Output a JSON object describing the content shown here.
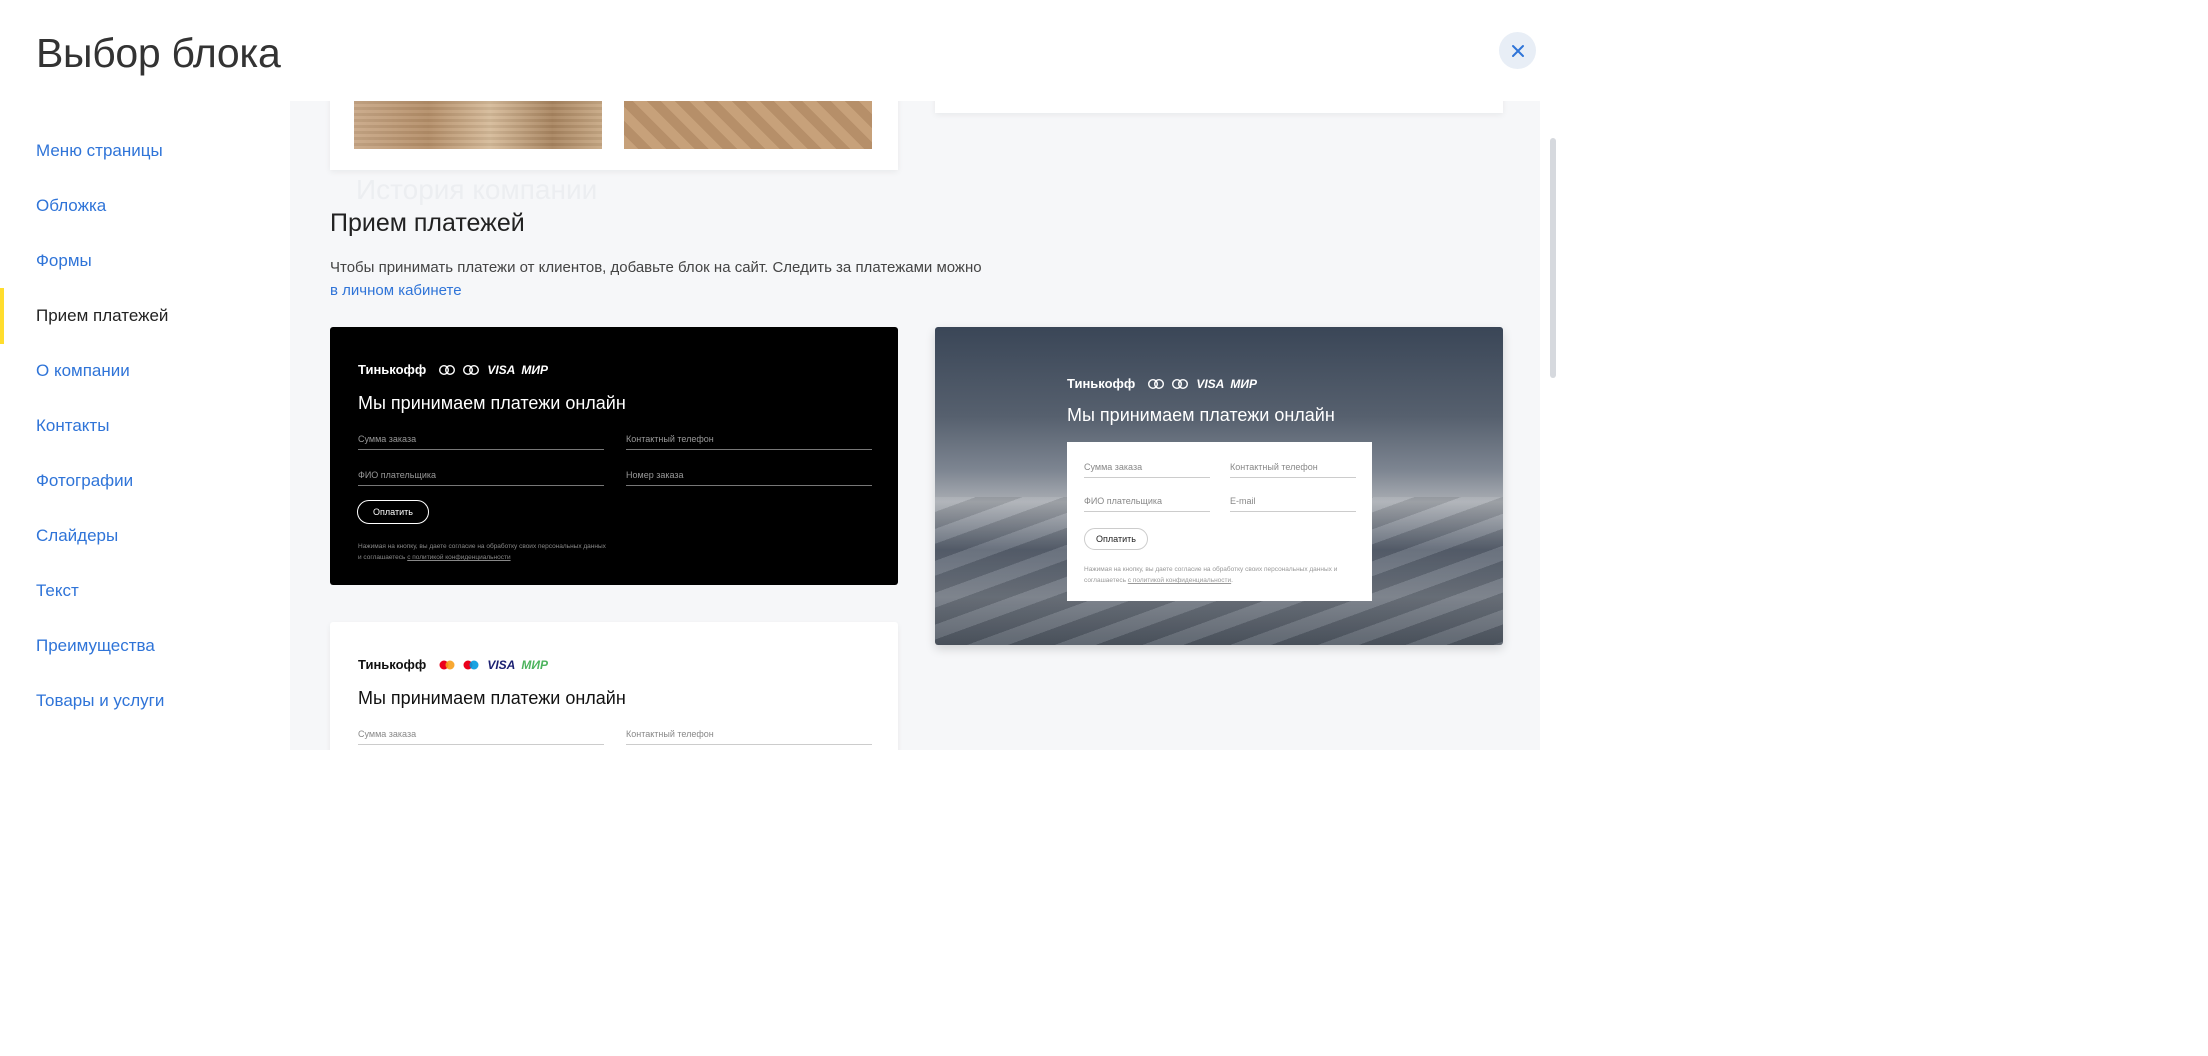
{
  "header": {
    "title": "Выбор блока",
    "close_icon": "close-icon"
  },
  "sidebar": {
    "items": [
      {
        "label": "Меню страницы",
        "active": false
      },
      {
        "label": "Обложка",
        "active": false
      },
      {
        "label": "Формы",
        "active": false
      },
      {
        "label": "Прием платежей",
        "active": true
      },
      {
        "label": "О компании",
        "active": false
      },
      {
        "label": "Контакты",
        "active": false
      },
      {
        "label": "Фотографии",
        "active": false
      },
      {
        "label": "Слайдеры",
        "active": false
      },
      {
        "label": "Текст",
        "active": false
      },
      {
        "label": "Преимущества",
        "active": false
      },
      {
        "label": "Товары и услуги",
        "active": false
      }
    ],
    "active_color": "#ffdd2d",
    "link_color": "#2f74d8"
  },
  "content": {
    "ghost_heading": "История компании",
    "section_title": "Прием платежей",
    "section_description": "Чтобы принимать платежи от клиентов, добавьте блок на сайт. Следить за платежами можно",
    "section_link": "в личном кабинете",
    "payment_card": {
      "brand": "Тинькофф",
      "visa": "VISA",
      "mir": "МИР",
      "heading": "Мы принимаем платежи онлайн",
      "field_sum": "Сумма заказа",
      "field_phone": "Контактный телефон",
      "field_name": "ФИО плательщика",
      "field_order": "Номер заказа",
      "field_email": "E-mail",
      "button": "Оплатить",
      "consent_text": "Нажимая на кнопку, вы даете согласие на обработку своих персональных данных и соглашаетесь",
      "consent_link": "с политикой конфиденциальности",
      "consent_end": "."
    }
  }
}
